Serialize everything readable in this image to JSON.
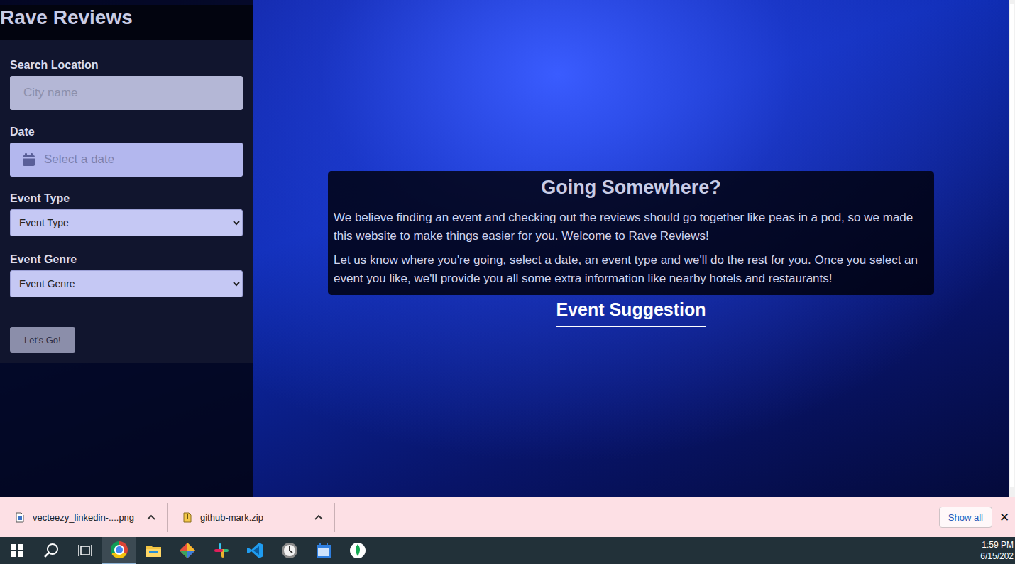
{
  "page": {
    "title": "Rave Reviews"
  },
  "form": {
    "fields": [
      {
        "label": "Search Location",
        "kind": "text",
        "placeholder": "City name"
      },
      {
        "label": "Date",
        "kind": "date",
        "placeholder": "Select a date"
      },
      {
        "label": "Event Type",
        "kind": "select",
        "value": "Event Type"
      },
      {
        "label": "Event Genre",
        "kind": "select",
        "value": "Event Genre"
      }
    ],
    "submit": "Let's Go!"
  },
  "intro": {
    "heading": "Going Somewhere?",
    "paragraphs": [
      "We believe finding an event and checking out the reviews should go together like peas in a pod, so we made this website to make things easier for you. Welcome to Rave Reviews!",
      "Let us know where you're going, select a date, an event type and we'll do the rest for you. Once you select an event you like, we'll provide you all some extra information like nearby hotels and restaurants!"
    ]
  },
  "suggestion": {
    "heading": "Event Suggestion"
  },
  "downloads": {
    "items": [
      {
        "name": "vecteezy_linkedin-....png",
        "kind": "image"
      },
      {
        "name": "github-mark.zip",
        "kind": "zip"
      }
    ],
    "show_all": "Show all",
    "close": "✕"
  },
  "taskbar": {
    "apps": [
      {
        "kind": "start",
        "active": false
      },
      {
        "kind": "search",
        "active": false
      },
      {
        "kind": "taskview",
        "active": false
      },
      {
        "kind": "chrome",
        "active": true
      },
      {
        "kind": "explorer",
        "active": false
      },
      {
        "kind": "gitkraken",
        "active": false
      },
      {
        "kind": "slack",
        "active": false
      },
      {
        "kind": "vscode",
        "active": false
      },
      {
        "kind": "clock",
        "active": false
      },
      {
        "kind": "calendar",
        "active": false
      },
      {
        "kind": "mongodb",
        "active": false
      }
    ],
    "time": "1:59 PM",
    "date": "6/15/202"
  }
}
